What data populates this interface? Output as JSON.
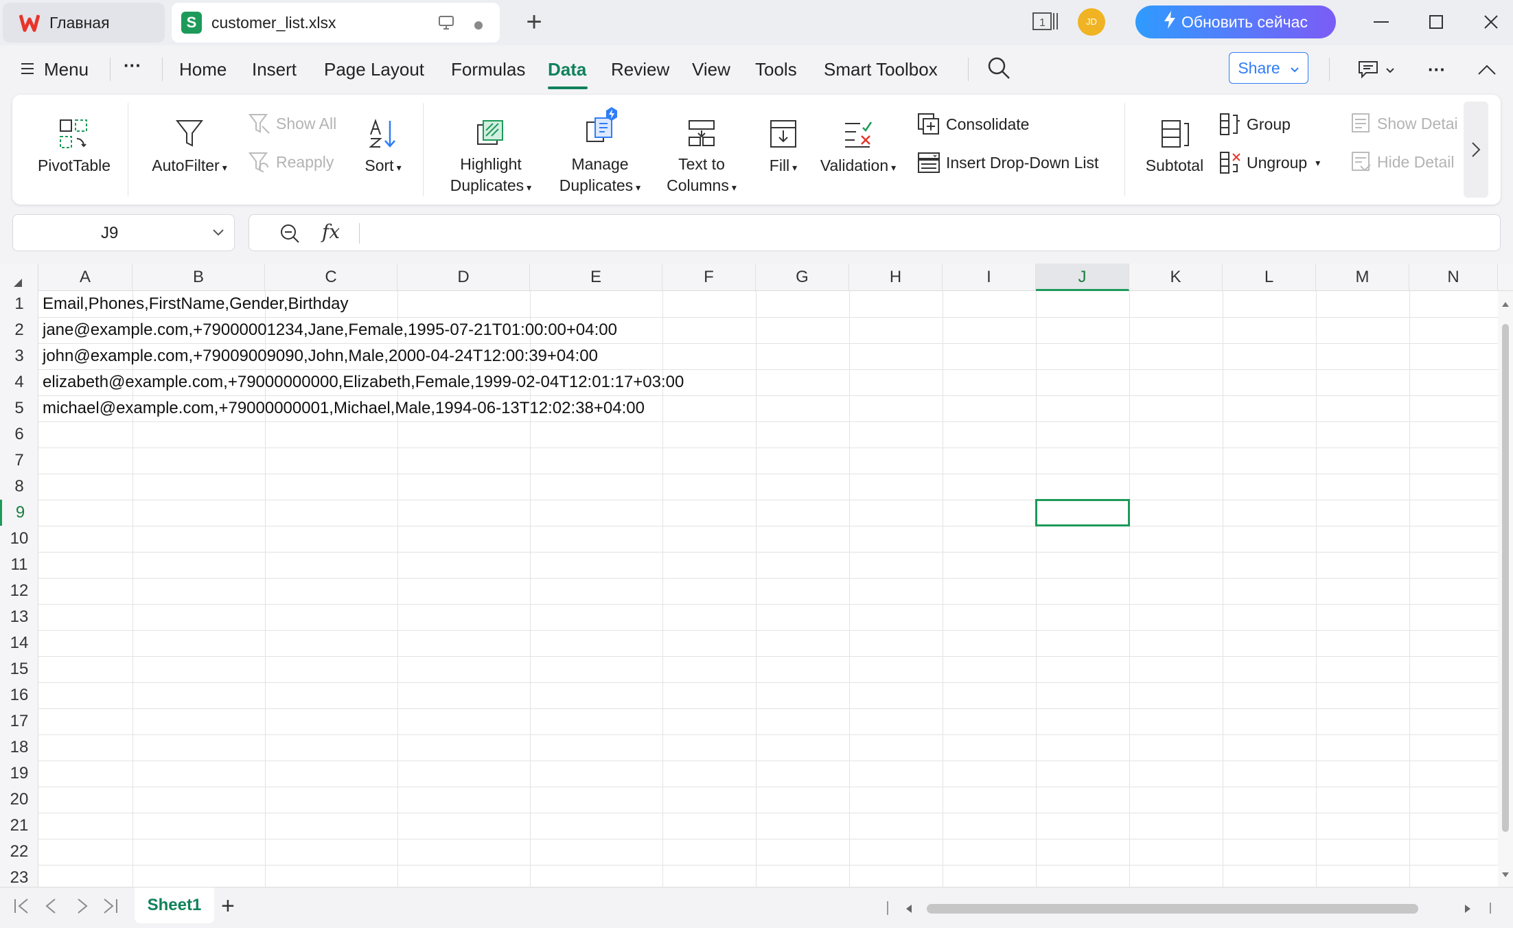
{
  "tabs": {
    "home_label": "Главная",
    "file_label": "customer_list.xlsx"
  },
  "titlebar": {
    "avatar_initials": "JD",
    "update_label": "Обновить сейчас",
    "layout_badge": "1"
  },
  "menu": {
    "menu_label": "Menu",
    "more_label": "···",
    "items": [
      "Home",
      "Insert",
      "Page Layout",
      "Formulas",
      "Data",
      "Review",
      "View",
      "Tools",
      "Smart Toolbox"
    ],
    "active": "Data",
    "share_label": "Share"
  },
  "ribbon": {
    "pivot_table": "PivotTable",
    "autofilter": "AutoFilter",
    "show_all": "Show All",
    "reapply": "Reapply",
    "sort": "Sort",
    "highlight_1": "Highlight",
    "highlight_2": "Duplicates",
    "manage_1": "Manage",
    "manage_2": "Duplicates",
    "text_to_1": "Text to",
    "text_to_2": "Columns",
    "fill": "Fill",
    "validation": "Validation",
    "consolidate": "Consolidate",
    "insert_dropdown": "Insert Drop-Down List",
    "subtotal": "Subtotal",
    "group": "Group",
    "ungroup": "Ungroup",
    "show_detail": "Show Detai",
    "hide_detail": "Hide Detail"
  },
  "formula": {
    "name_box": "J9",
    "fx_label": "fx",
    "content": ""
  },
  "grid": {
    "columns": [
      "A",
      "B",
      "C",
      "D",
      "E",
      "F",
      "G",
      "H",
      "I",
      "J",
      "K",
      "L",
      "M",
      "N"
    ],
    "selected_column": "J",
    "rows": [
      "1",
      "2",
      "3",
      "4",
      "5",
      "6",
      "7",
      "8",
      "9",
      "10",
      "11",
      "12",
      "13",
      "14",
      "15",
      "16",
      "17",
      "18",
      "19",
      "20",
      "21",
      "22",
      "23"
    ],
    "selected_row": "9",
    "cells_A": [
      "Email,Phones,FirstName,Gender,Birthday",
      "jane@example.com,+79000001234,Jane,Female,1995-07-21T01:00:00+04:00",
      "john@example.com,+79009009090,John,Male,2000-04-24T12:00:39+04:00",
      "elizabeth@example.com,+79000000000,Elizabeth,Female,1999-02-04T12:01:17+03:00",
      "michael@example.com,+79000000001,Michael,Male,1994-06-13T12:02:38+04:00"
    ]
  },
  "sheets": {
    "active_sheet": "Sheet1",
    "add_label": "+"
  },
  "colors": {
    "accent": "#11825a",
    "selection": "#1d9a59",
    "share": "#2f7df6"
  }
}
